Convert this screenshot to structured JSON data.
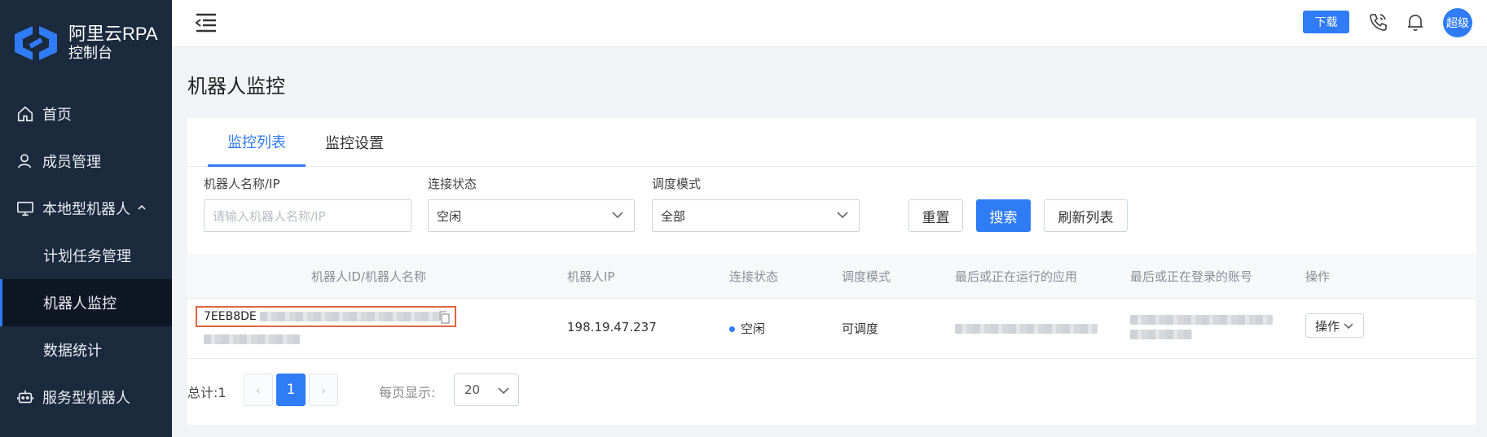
{
  "app": {
    "title": "阿里云RPA",
    "subtitle": "控制台"
  },
  "sidebar": {
    "items": [
      {
        "label": "首页",
        "icon": "home-icon"
      },
      {
        "label": "成员管理",
        "icon": "user-icon"
      },
      {
        "label": "本地型机器人",
        "icon": "monitor-icon",
        "expanded": true
      },
      {
        "label": "计划任务管理"
      },
      {
        "label": "机器人监控",
        "active": true
      },
      {
        "label": "数据统计"
      },
      {
        "label": "服务型机器人",
        "icon": "robot-icon"
      }
    ]
  },
  "header": {
    "download_label": "下载",
    "avatar_label": "超级",
    "icons": [
      "menu-fold-icon",
      "phone-icon",
      "bell-icon"
    ]
  },
  "page": {
    "title": "机器人监控"
  },
  "tabs": [
    {
      "label": "监控列表",
      "active": true
    },
    {
      "label": "监控设置",
      "active": false
    }
  ],
  "filters": {
    "name_label": "机器人名称/IP",
    "name_placeholder": "请输入机器人名称/IP",
    "status_label": "连接状态",
    "status_value": "空闲",
    "mode_label": "调度模式",
    "mode_value": "全部",
    "reset_label": "重置",
    "search_label": "搜索",
    "refresh_label": "刷新列表"
  },
  "table": {
    "columns": [
      "机器人ID/机器人名称",
      "机器人IP",
      "连接状态",
      "调度模式",
      "最后或正在运行的应用",
      "最后或正在登录的账号",
      "操作"
    ],
    "rows": [
      {
        "id_prefix": "7EEB8DE",
        "ip": "198.19.47.237",
        "status": "空闲",
        "mode": "可调度",
        "action": "操作"
      }
    ]
  },
  "pagination": {
    "total_label": "总计:1",
    "prev": "‹",
    "current": "1",
    "next": "›",
    "per_page_label": "每页显示:",
    "page_size": "20"
  },
  "colors": {
    "accent": "#2f7cf6",
    "sidebar": "#1b2a3d",
    "highlight_border": "#e0663f"
  }
}
